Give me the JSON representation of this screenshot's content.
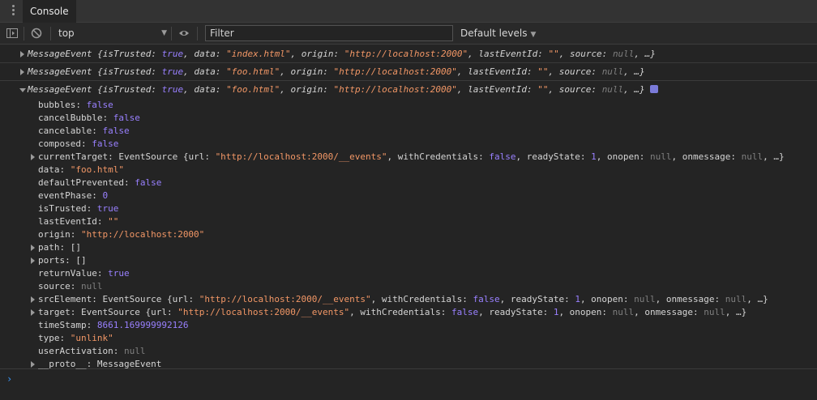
{
  "tabs": {
    "console_label": "Console"
  },
  "toolbar": {
    "context_label": "top",
    "filter_placeholder": "Filter",
    "levels_label": "Default levels"
  },
  "messages": [
    {
      "name": "MessageEvent",
      "isTrusted": "true",
      "data": "\"index.html\"",
      "origin": "\"http://localhost:2000\"",
      "lastEventId": "\"\"",
      "source": "null"
    },
    {
      "name": "MessageEvent",
      "isTrusted": "true",
      "data": "\"foo.html\"",
      "origin": "\"http://localhost:2000\"",
      "lastEventId": "\"\"",
      "source": "null"
    },
    {
      "name": "MessageEvent",
      "isTrusted": "true",
      "data": "\"foo.html\"",
      "origin": "\"http://localhost:2000\"",
      "lastEventId": "\"\"",
      "source": "null"
    }
  ],
  "expanded": {
    "bubbles": "false",
    "cancelBubble": "false",
    "cancelable": "false",
    "composed": "false",
    "currentTarget_cls": "EventSource",
    "currentTarget_url": "\"http://localhost:2000/__events\"",
    "currentTarget_withCredentials": "false",
    "currentTarget_readyState": "1",
    "currentTarget_onopen": "null",
    "currentTarget_onmessage": "null",
    "data": "\"foo.html\"",
    "defaultPrevented": "false",
    "eventPhase": "0",
    "isTrusted": "true",
    "lastEventId": "\"\"",
    "origin": "\"http://localhost:2000\"",
    "path": "[]",
    "ports": "[]",
    "returnValue": "true",
    "source": "null",
    "srcElement_cls": "EventSource",
    "srcElement_url": "\"http://localhost:2000/__events\"",
    "srcElement_withCredentials": "false",
    "srcElement_readyState": "1",
    "srcElement_onopen": "null",
    "srcElement_onmessage": "null",
    "target_cls": "EventSource",
    "target_url": "\"http://localhost:2000/__events\"",
    "target_withCredentials": "false",
    "target_readyState": "1",
    "target_onopen": "null",
    "target_onmessage": "null",
    "timeStamp": "8661.169999992126",
    "type": "\"unlink\"",
    "userActivation": "null",
    "proto": "MessageEvent"
  },
  "icons": {
    "sidebar": "sidebar-toggle-icon",
    "clear": "clear-console-icon",
    "eye": "eye-icon",
    "prompt": "prompt-chevron-icon"
  },
  "colors": {
    "string": "#f29766",
    "keyword": "#9980ff",
    "null": "#7f7f7f",
    "prompt": "#3a96f8"
  }
}
